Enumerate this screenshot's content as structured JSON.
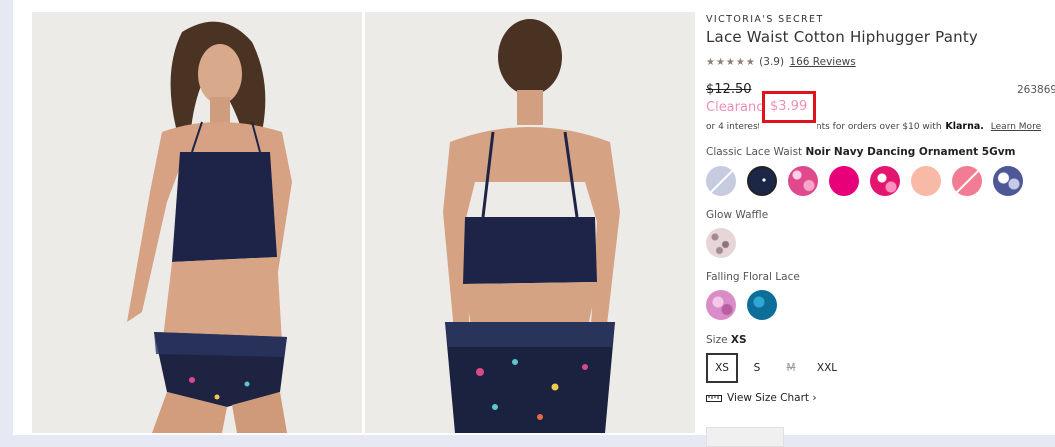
{
  "product": {
    "brand": "VICTORIA'S SECRET",
    "title": "Lace Waist Cotton Hiphugger Panty",
    "rating": "(3.9)",
    "stars": "★★★★★",
    "reviews": "166 Reviews",
    "original_price": "$12.50",
    "clearance_label": "Clearance",
    "sale_price": "$3.99",
    "sku": "263869",
    "klarna": {
      "prefix": "or 4 interest-free payments for orders over $10 with",
      "brand": "Klarna.",
      "link": "Learn More"
    }
  },
  "colors": {
    "group1_label": "Classic Lace Waist",
    "group1_selected": "Noir Navy Dancing Ornament 5Gvm",
    "group2_label": "Glow Waffle",
    "group3_label": "Falling Floral Lace"
  },
  "size": {
    "label": "Size",
    "selected": "XS",
    "options": [
      "XS",
      "S",
      "M",
      "XXL"
    ],
    "chart_link": "View Size Chart ›"
  },
  "theme": {
    "accent_pink": "#ef8fb6",
    "highlight_red": "#e0121b"
  },
  "icons": {
    "ruler": "ruler-icon"
  }
}
